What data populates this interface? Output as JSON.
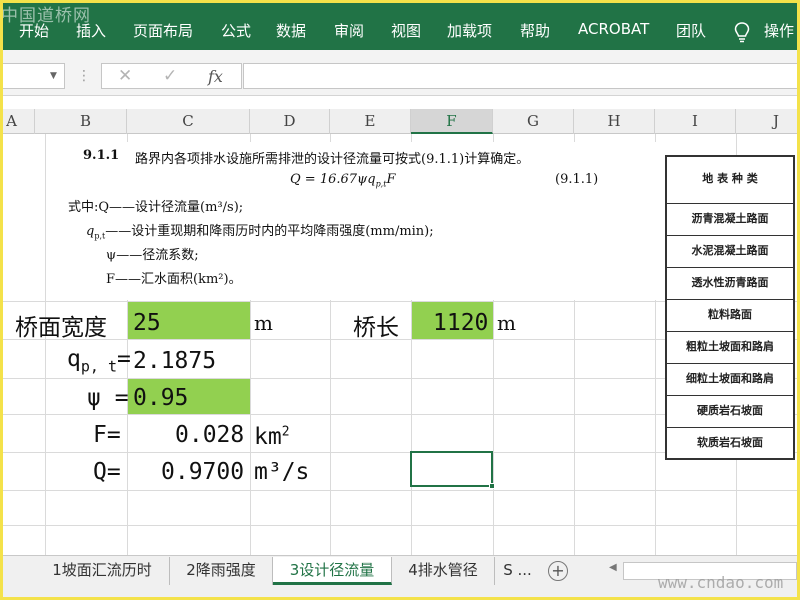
{
  "watermark_top": "中国道桥网",
  "watermark_bottom": "www.cndao.com",
  "ribbon": {
    "tabs": [
      "开始",
      "插入",
      "页面布局",
      "公式",
      "数据",
      "审阅",
      "视图",
      "加载项",
      "帮助",
      "ACROBAT",
      "团队",
      "操作"
    ],
    "accent": "#217346"
  },
  "formula_bar": {
    "cancel": "✕",
    "enter": "✓",
    "fx": "fx",
    "name_box": "",
    "value": ""
  },
  "columns": [
    "A",
    "B",
    "C",
    "D",
    "E",
    "F",
    "G",
    "H",
    "I",
    "J"
  ],
  "selected_column": "F",
  "ref_image": {
    "clause": "9.1.1",
    "title": "路界内各项排水设施所需排泄的设计径流量可按式(9.1.1)计算确定。",
    "formula": "Q = 16.67ψq",
    "formula_sub": "p,t",
    "formula_tail": "F",
    "formula_no": "(9.1.1)",
    "where_q": "式中:Q——设计径流量(m³/s);",
    "where_qpt": "——设计重现期和降雨历时内的平均降雨强度(mm/min);",
    "where_qpt_sym": "q",
    "where_qpt_sub": "p,t",
    "where_psi": "ψ——径流系数;",
    "where_f": "F——汇水面积(km²)。"
  },
  "legend_table": {
    "header": "地 表 种 类",
    "rows": [
      "沥青混凝土路面",
      "水泥混凝土路面",
      "透水性沥青路面",
      "粒料路面",
      "粗粒土坡面和路肩",
      "细粒土坡面和路肩",
      "硬质岩石坡面",
      "软质岩石坡面"
    ]
  },
  "sheet": {
    "bridge_width_label": "桥面宽度",
    "bridge_width_value": "25",
    "bridge_width_unit": "m",
    "bridge_length_label": "桥长",
    "bridge_length_value": "1120",
    "bridge_length_unit": "m",
    "qpt_label": "q",
    "qpt_sub": "p, t",
    "qpt_eq": "=",
    "qpt_value": "2.1875",
    "psi_label": "ψ =",
    "psi_value": "0.95",
    "f_label": "F=",
    "f_value": "0.028",
    "f_unit": "km",
    "f_unit_sup": "2",
    "q_label": "Q=",
    "q_value": "0.9700",
    "q_unit": "m³/s",
    "highlight_color": "#92d050"
  },
  "sheet_tabs": [
    {
      "label": "1坡面汇流历时",
      "active": false
    },
    {
      "label": "2降雨强度",
      "active": false
    },
    {
      "label": "3设计径流量",
      "active": true
    },
    {
      "label": "4排水管径",
      "active": false
    },
    {
      "label": "S ...",
      "active": false
    }
  ]
}
